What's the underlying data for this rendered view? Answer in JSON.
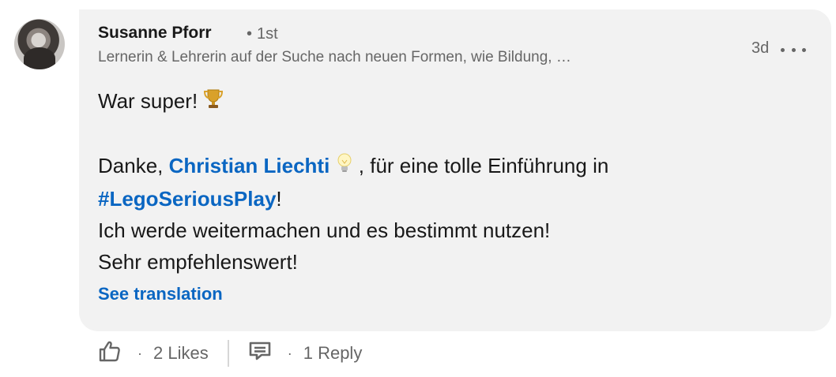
{
  "comment": {
    "author_name": "Susanne Pforr",
    "degree": "1st",
    "degree_dot": "•",
    "headline": "Lernerin & Lehrerin auf der Suche nach neuen Formen, wie Bildung, …",
    "timestamp": "3d",
    "lines": {
      "line1": "War super!",
      "line2_prefix": "Danke, ",
      "mention": "Christian Liechti",
      "line2_suffix": " , für eine tolle Einführung in",
      "hashtag": "#LegoSeriousPlay",
      "hashtag_suffix": "!",
      "line3": "Ich werde weitermachen und es bestimmt nutzen!",
      "line4": "Sehr empfehlenswert!"
    },
    "see_translation": "See translation"
  },
  "actions": {
    "likes_label": "2 Likes",
    "reply_label": "1 Reply",
    "separator": "·"
  },
  "icons": {
    "trophy": "trophy-icon",
    "lightbulb": "lightbulb-icon",
    "like": "thumbs-up-icon",
    "reply": "comment-icon",
    "more": "more-options-icon"
  },
  "colors": {
    "link": "#0a66c2",
    "bubble": "#f2f2f2",
    "secondary_text": "#666666"
  }
}
